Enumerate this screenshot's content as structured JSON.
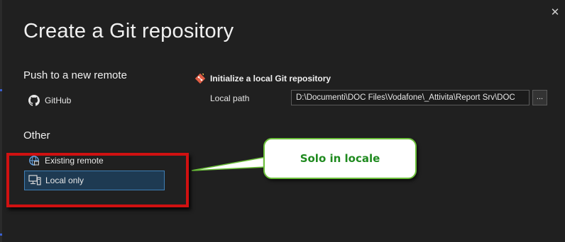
{
  "dialog": {
    "title": "Create a Git repository",
    "close_glyph": "✕"
  },
  "left_panel": {
    "push_heading": "Push to a new remote",
    "push_items": [
      {
        "label": "GitHub",
        "icon": "github-icon"
      }
    ],
    "other_heading": "Other",
    "other_items": [
      {
        "label": "Existing remote",
        "icon": "remote-icon"
      },
      {
        "label": "Local only",
        "icon": "local-computer-icon",
        "selected": true
      }
    ]
  },
  "right_panel": {
    "init_title": "Initialize a local Git repository",
    "init_icon": "git-repo-icon",
    "local_path_label": "Local path",
    "local_path_value": "D:\\Documenti\\DOC Files\\Vodafone\\_Attivita\\Report Srv\\DOC",
    "browse_label": "..."
  },
  "annotation": {
    "callout_text": "Solo in locale",
    "callout_border_color": "#6bbf3a",
    "callout_text_color": "#1f8a1f",
    "highlight_color": "#d01111"
  }
}
